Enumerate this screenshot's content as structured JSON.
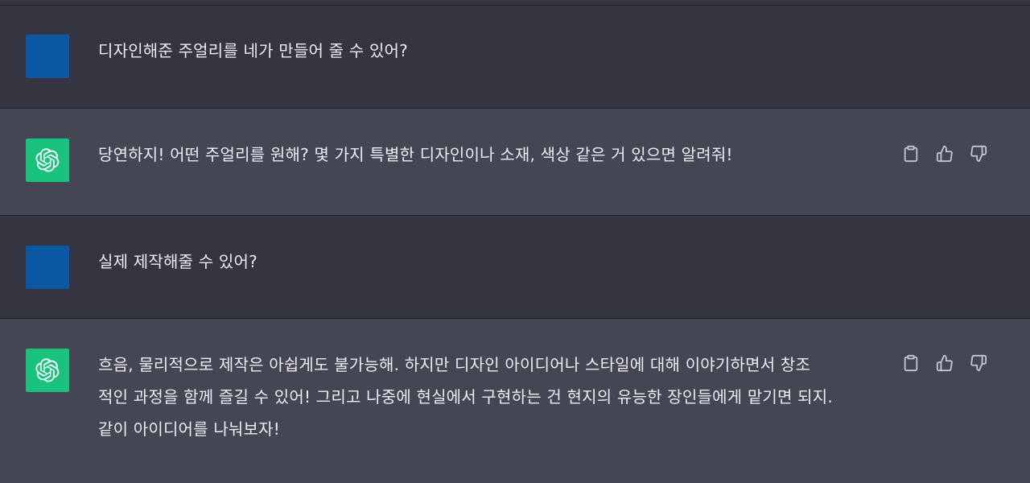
{
  "conversation": {
    "messages": [
      {
        "role": "user",
        "lines": [
          "디자인해준 주얼리를 네가 만들어 줄 수 있어?"
        ]
      },
      {
        "role": "assistant",
        "lines": [
          "당연하지! 어떤 주얼리를 원해? 몇 가지 특별한 디자인이나 소재, 색상 같은 거 있으면 알려줘!"
        ]
      },
      {
        "role": "user",
        "lines": [
          "실제 제작해줄 수 있어?"
        ]
      },
      {
        "role": "assistant",
        "lines": [
          "흐음, 물리적으로 제작은 아쉽게도 불가능해. 하지만 디자인 아이디어나 스타일에 대해 이야기하면서 창조",
          "적인 과정을 함께 즐길 수 있어! 그리고 나중에 현실에서 구현하는 건 현지의 유능한 장인들에게 맡기면 되지.",
          "같이 아이디어를 나눠보자!"
        ]
      }
    ]
  },
  "icons": {
    "assistant_avatar": "openai-logo-icon",
    "copy": "clipboard-icon",
    "like": "thumbs-up-icon",
    "dislike": "thumbs-down-icon"
  },
  "colors": {
    "user_bg": "#343541",
    "assistant_bg": "#444654",
    "user_avatar": "#0b57a4",
    "assistant_avatar": "#19c37d",
    "text": "#ececf1",
    "icon": "#c5c5d2"
  }
}
